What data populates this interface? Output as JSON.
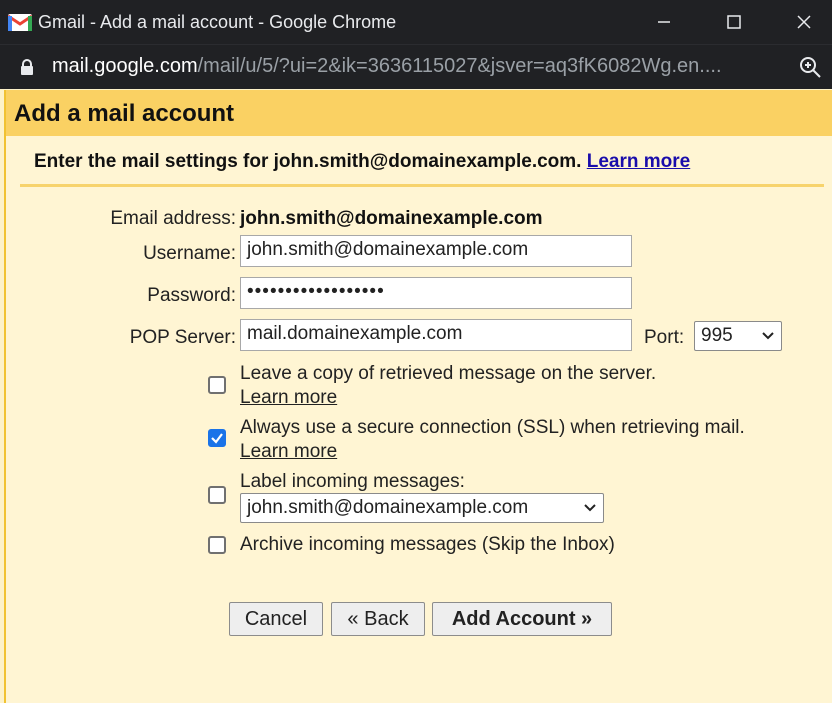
{
  "window": {
    "title": "Gmail - Add a mail account - Google Chrome",
    "url_host": "mail.google.com",
    "url_path": "/mail/u/5/?ui=2&ik=3636115027&jsver=aq3fK6082Wg.en...."
  },
  "dialog": {
    "title": "Add a mail account",
    "intro": "Enter the mail settings for john.smith@domainexample.com.",
    "intro_link": "Learn more"
  },
  "form": {
    "email_label": "Email address:",
    "email_value": "john.smith@domainexample.com",
    "username_label": "Username:",
    "username_value": "john.smith@domainexample.com",
    "password_label": "Password:",
    "password_value": "••••••••••••••••••",
    "pop_label": "POP Server:",
    "pop_value": "mail.domainexample.com",
    "port_label": "Port:",
    "port_value": "995"
  },
  "options": [
    {
      "text": "Leave a copy of retrieved message on the server.",
      "link": "Learn more",
      "checked": false
    },
    {
      "text": "Always use a secure connection (SSL) when retrieving mail.",
      "link": "Learn more",
      "checked": true
    },
    {
      "text": "Label incoming messages:",
      "select_value": "john.smith@domainexample.com",
      "checked": false
    },
    {
      "text": "Archive incoming messages (Skip the Inbox)",
      "checked": false
    }
  ],
  "buttons": {
    "cancel": "Cancel",
    "back": "« Back",
    "add": "Add Account »"
  },
  "colors": {
    "accent_blue": "#1a73e8",
    "header_yellow": "#fad163",
    "background": "#fff5d3"
  }
}
